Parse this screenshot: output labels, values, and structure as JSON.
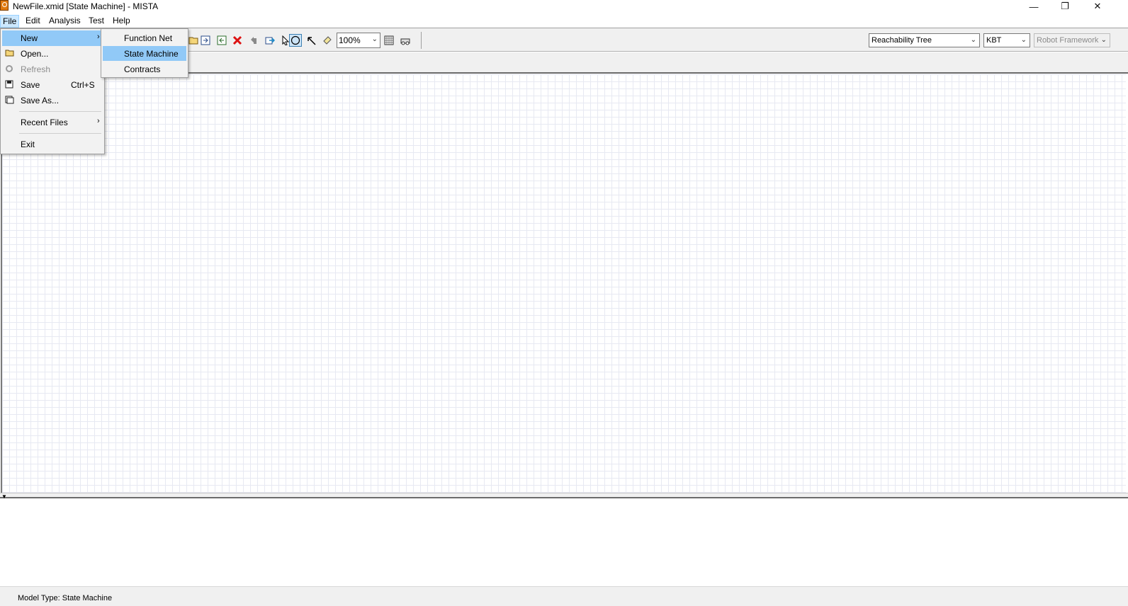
{
  "window": {
    "title": "NewFile.xmid [State Machine] - MISTA",
    "minimize": "—",
    "maximize": "❐",
    "close": "✕"
  },
  "menubar": {
    "items": [
      "File",
      "Edit",
      "Analysis",
      "Test",
      "Help"
    ]
  },
  "file_menu": {
    "new": "New",
    "open": "Open...",
    "refresh": "Refresh",
    "save": "Save",
    "save_shortcut": "Ctrl+S",
    "save_as": "Save As...",
    "recent_files": "Recent Files",
    "exit": "Exit"
  },
  "new_submenu": {
    "items": [
      "Function Net",
      "State Machine",
      "Contracts"
    ],
    "highlighted": "State Machine"
  },
  "toolbar": {
    "icons": [
      "open-model-icon",
      "import-icon",
      "export-icon",
      "delete-icon",
      "undo-icon",
      "redo-icon",
      "select-icon",
      "state-icon",
      "transition-icon",
      "annotation-icon",
      "grid-icon",
      "print-icon"
    ],
    "zoom": "100%",
    "analysis_select": "Reachability Tree",
    "test_type_select": "KBT",
    "framework_select": "Robot Framework"
  },
  "status": {
    "text": "Model Type: State Machine"
  },
  "colors": {
    "highlight": "#91c9f7",
    "grid_line": "#e7e9f2",
    "menu_active": "#cce8ff"
  }
}
